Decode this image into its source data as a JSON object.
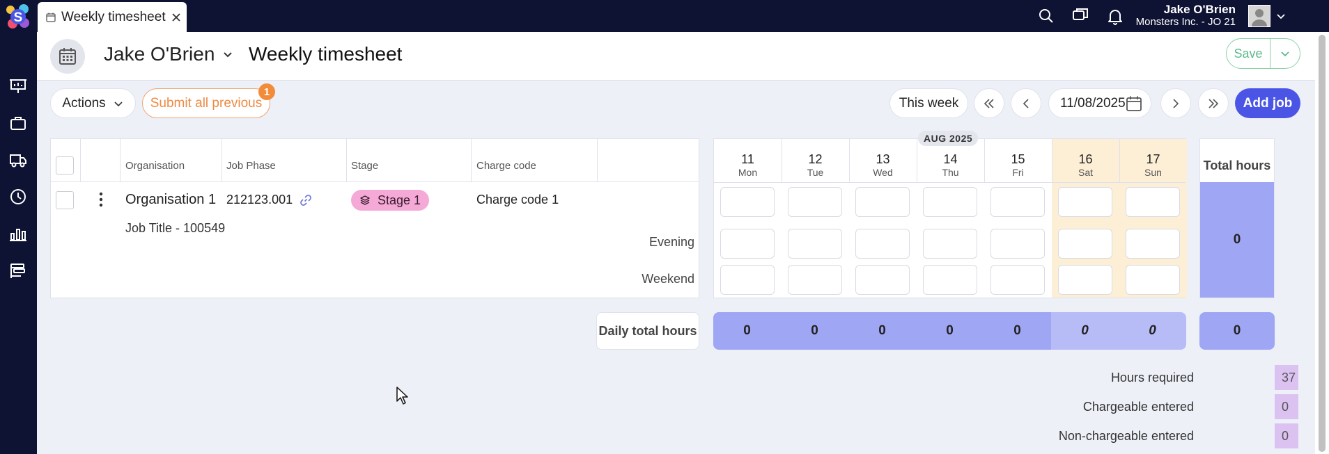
{
  "window": {
    "tab_title": "Weekly timesheet"
  },
  "user": {
    "name": "Jake O'Brien",
    "org": "Monsters Inc. - JO 21"
  },
  "header": {
    "person": "Jake O'Brien",
    "title": "Weekly timesheet",
    "save_label": "Save"
  },
  "toolbar": {
    "actions_label": "Actions",
    "submit_label": "Submit all previous",
    "submit_badge": "1",
    "this_week_label": "This week",
    "date_value": "11/08/2025",
    "add_job_label": "Add job"
  },
  "table": {
    "columns": [
      "Organisation",
      "Job Phase",
      "Stage",
      "Charge code"
    ],
    "row": {
      "organisation": "Organisation 1",
      "job_phase": "212123.001",
      "stage": "Stage 1",
      "charge_code": "Charge code 1",
      "job_title": "Job Title - 100549",
      "sub_rows": [
        "Evening",
        "Weekend"
      ]
    }
  },
  "week": {
    "month": "AUG 2025",
    "days": [
      {
        "num": "11",
        "name": "Mon"
      },
      {
        "num": "12",
        "name": "Tue"
      },
      {
        "num": "13",
        "name": "Wed"
      },
      {
        "num": "14",
        "name": "Thu"
      },
      {
        "num": "15",
        "name": "Fri"
      },
      {
        "num": "16",
        "name": "Sat"
      },
      {
        "num": "17",
        "name": "Sun"
      }
    ],
    "total_header": "Total hours",
    "row_total": "0",
    "daily_label": "Daily total hours",
    "daily_totals": [
      "0",
      "0",
      "0",
      "0",
      "0",
      "0",
      "0"
    ],
    "grand_total": "0"
  },
  "summary": [
    {
      "label": "Hours required",
      "value": "37"
    },
    {
      "label": "Chargeable entered",
      "value": "0"
    },
    {
      "label": "Non-chargeable entered",
      "value": "0"
    }
  ],
  "colors": {
    "accent": "#4a55e6",
    "nav": "#0e1233",
    "save": "#5cb98a",
    "submit": "#ee8a43",
    "total": "#9fa6f4",
    "stage": "#f4a9d6"
  }
}
